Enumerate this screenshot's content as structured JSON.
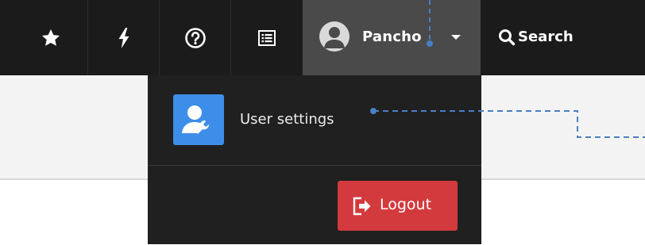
{
  "navbar": {
    "icons": [
      "star-icon",
      "bolt-icon",
      "help-icon",
      "list-icon"
    ],
    "user_name": "Pancho",
    "search_label": "Search"
  },
  "dropdown": {
    "settings_label": "User settings",
    "logout_label": "Logout"
  },
  "colors": {
    "navbar_bg": "#1b1b1b",
    "user_menu_active_bg": "#4a4a4a",
    "dropdown_bg": "#202020",
    "settings_icon_bg": "#3d8ee8",
    "logout_bg": "#d33a3d",
    "guide_line": "#4a7fc1"
  }
}
